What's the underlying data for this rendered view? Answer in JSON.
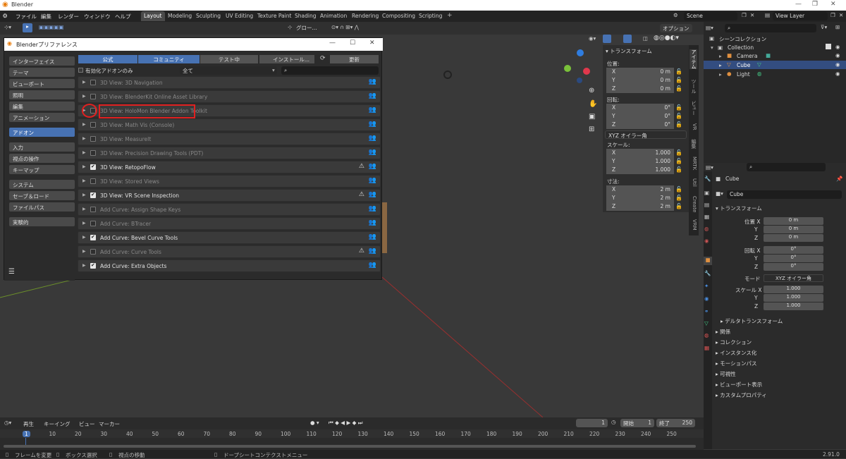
{
  "app": {
    "title": "Blender",
    "version": "2.91.0"
  },
  "menu": {
    "items": [
      "ファイル",
      "編集",
      "レンダー",
      "ウィンドウ",
      "ヘルプ"
    ]
  },
  "workspaces": [
    "Layout",
    "Modeling",
    "Sculpting",
    "UV Editing",
    "Texture Paint",
    "Shading",
    "Animation",
    "Rendering",
    "Compositing",
    "Scripting"
  ],
  "scene": {
    "name": "Scene",
    "view_layer": "View Layer"
  },
  "viewport_header": {
    "transform_orientation": "グロー...",
    "options": "オプション"
  },
  "prefs": {
    "title": "Blenderプリファレンス",
    "nav_group1": [
      "インターフェイス",
      "テーマ",
      "ビューポート",
      "照明",
      "編集",
      "アニメーション"
    ],
    "nav_addon": "アドオン",
    "nav_group2": [
      "入力",
      "視点の操作",
      "キーマップ"
    ],
    "nav_group3": [
      "システム",
      "セーブ＆ロード",
      "ファイルパス"
    ],
    "nav_group4": [
      "実験的"
    ],
    "tabs": {
      "official": "公式",
      "community": "コミュニティ",
      "testing": "テスト中",
      "install": "インストール...",
      "refresh": "更新"
    },
    "enabled_only": "有効化アドオンのみ",
    "category": "全て",
    "addons": [
      {
        "name": "3D View: 3D Navigation",
        "enabled": false,
        "warn": false
      },
      {
        "name": "3D View: BlenderKit Online Asset Library",
        "enabled": false,
        "warn": false
      },
      {
        "name": "3D View: HoloMon Blender Addon Toolkit",
        "enabled": false,
        "warn": false
      },
      {
        "name": "3D View: Math Vis (Console)",
        "enabled": false,
        "warn": false
      },
      {
        "name": "3D View: MeasureIt",
        "enabled": false,
        "warn": false
      },
      {
        "name": "3D View: Precision Drawing Tools (PDT)",
        "enabled": false,
        "warn": false
      },
      {
        "name": "3D View: RetopoFlow",
        "enabled": true,
        "warn": true
      },
      {
        "name": "3D View: Stored Views",
        "enabled": false,
        "warn": false
      },
      {
        "name": "3D View: VR Scene Inspection",
        "enabled": true,
        "warn": true
      },
      {
        "name": "Add Curve: Assign Shape Keys",
        "enabled": false,
        "warn": false
      },
      {
        "name": "Add Curve: BTracer",
        "enabled": false,
        "warn": false
      },
      {
        "name": "Add Curve: Bevel Curve Tools",
        "enabled": true,
        "warn": false
      },
      {
        "name": "Add Curve: Curve Tools",
        "enabled": false,
        "warn": true
      },
      {
        "name": "Add Curve: Extra Objects",
        "enabled": true,
        "warn": false
      }
    ]
  },
  "npanel": {
    "header": "トランスフォーム",
    "location_label": "位置:",
    "location": [
      {
        "k": "X",
        "v": "0 m"
      },
      {
        "k": "Y",
        "v": "0 m"
      },
      {
        "k": "Z",
        "v": "0 m"
      }
    ],
    "rotation_label": "回転:",
    "rotation": [
      {
        "k": "X",
        "v": "0°"
      },
      {
        "k": "Y",
        "v": "0°"
      },
      {
        "k": "Z",
        "v": "0°"
      }
    ],
    "rotation_mode": "XYZ オイラー角",
    "scale_label": "スケール:",
    "scale": [
      {
        "k": "X",
        "v": "1.000"
      },
      {
        "k": "Y",
        "v": "1.000"
      },
      {
        "k": "Z",
        "v": "1.000"
      }
    ],
    "dimensions_label": "寸法:",
    "dimensions": [
      {
        "k": "X",
        "v": "2 m"
      },
      {
        "k": "Y",
        "v": "2 m"
      },
      {
        "k": "Z",
        "v": "2 m"
      }
    ],
    "tabs": [
      "アイテム",
      "ツール",
      "ビュー",
      "VR",
      "編集",
      "MRTK",
      "Util",
      "Create",
      "VRM"
    ]
  },
  "outliner": {
    "root": "シーンコレクション",
    "collection": "Collection",
    "items": [
      "Camera",
      "Cube",
      "Light"
    ]
  },
  "properties": {
    "object_name": "Cube",
    "object_field": "Cube",
    "transform_header": "トランスフォーム",
    "location_label": "位置 X",
    "location": [
      "0 m",
      "0 m",
      "0 m"
    ],
    "rotation_label": "回転 X",
    "rotation": [
      "0°",
      "0°",
      "0°"
    ],
    "mode_label": "モード",
    "mode": "XYZ オイラー角",
    "scale_label": "スケール X",
    "scale": [
      "1.000",
      "1.000",
      "1.000"
    ],
    "axis_y": "Y",
    "axis_z": "Z",
    "delta": "デルタトランスフォーム",
    "sections": [
      "関係",
      "コレクション",
      "インスタンス化",
      "モーションパス",
      "可視性",
      "ビューポート表示",
      "カスタムプロパティ"
    ]
  },
  "timeline": {
    "menus": [
      "再生",
      "キーイング",
      "ビュー",
      "マーカー"
    ],
    "current_frame": "1",
    "start_label": "開始",
    "start": "1",
    "end_label": "終了",
    "end": "250",
    "ruler": [
      "1",
      "10",
      "20",
      "30",
      "40",
      "50",
      "60",
      "70",
      "80",
      "90",
      "100",
      "110",
      "120",
      "130",
      "140",
      "150",
      "160",
      "170",
      "180",
      "190",
      "200",
      "210",
      "220",
      "230",
      "240",
      "250"
    ]
  },
  "status": {
    "items": [
      "フレームを変更",
      "ボックス選択",
      "視点の移動",
      "ドープシートコンテクストメニュー"
    ]
  },
  "colors": {
    "accent": "#4772b3",
    "highlight_box": "#e02020"
  }
}
